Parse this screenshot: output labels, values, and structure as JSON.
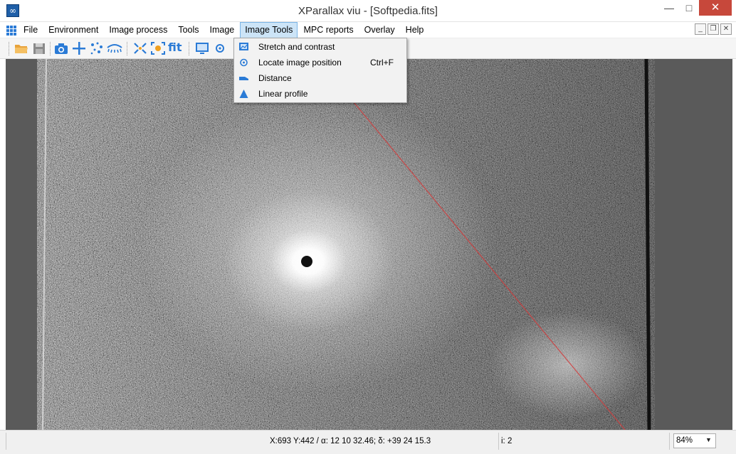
{
  "window": {
    "title": "XParallax viu - [Softpedia.fits]",
    "app_icon_glyph": "∞",
    "minimize_glyph": "—",
    "maximize_glyph": "□",
    "close_glyph": "✕"
  },
  "menubar": {
    "items": [
      {
        "label": "File"
      },
      {
        "label": "Environment"
      },
      {
        "label": "Image process"
      },
      {
        "label": "Tools"
      },
      {
        "label": "Image"
      },
      {
        "label": "Image Tools"
      },
      {
        "label": "MPC reports"
      },
      {
        "label": "Overlay"
      },
      {
        "label": "Help"
      }
    ],
    "active_index": 5,
    "mdi_buttons": [
      "_",
      "❐",
      "✕"
    ]
  },
  "toolbar": {
    "icons": [
      "folder-open-icon",
      "save-icon",
      "camera-icon",
      "crosshair-icon",
      "stars-icon",
      "eye-icon",
      "shrink-icon",
      "target-icon",
      "fit-icon",
      "monitor-icon",
      "locate-icon"
    ],
    "fit_label": "fit"
  },
  "image_tools_menu": {
    "items": [
      {
        "label": "Stretch and contrast",
        "icon": "stretch-icon",
        "shortcut": ""
      },
      {
        "label": "Locate image position",
        "icon": "locate-icon",
        "shortcut": "Ctrl+F"
      },
      {
        "label": "Distance",
        "icon": "ruler-icon",
        "shortcut": ""
      },
      {
        "label": "Linear profile",
        "icon": "profile-icon",
        "shortcut": ""
      }
    ]
  },
  "status": {
    "coordinates": "X:693 Y:442 / α: 12 10 32.46; δ: +39 24 15.3",
    "count": "i: 2",
    "zoom": "84%",
    "zoom_arrow": "▼"
  },
  "colors": {
    "accent": "#2b7bd6",
    "menu_highlight": "#cce4f7",
    "close_red": "#c7483b",
    "track_red": "#d23b3b"
  }
}
